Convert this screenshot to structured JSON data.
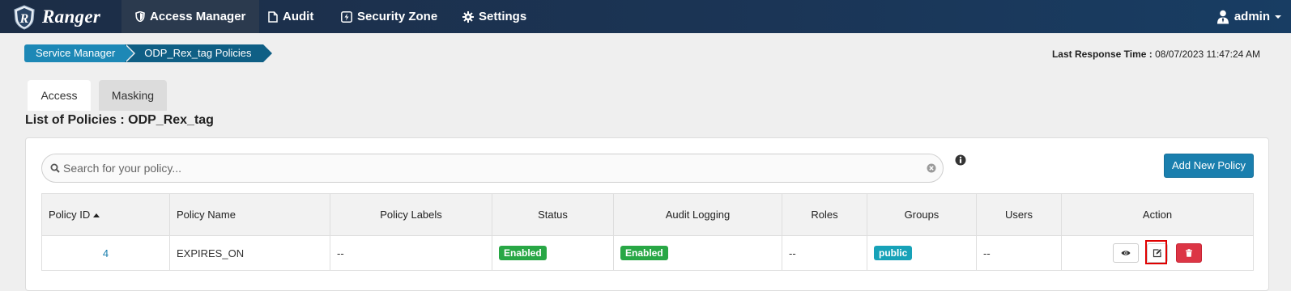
{
  "navbar": {
    "brand": "Ranger",
    "items": [
      {
        "label": "Access Manager",
        "icon": "shield-icon",
        "active": true
      },
      {
        "label": "Audit",
        "icon": "file-icon",
        "active": false
      },
      {
        "label": "Security Zone",
        "icon": "bolt-icon",
        "active": false
      },
      {
        "label": "Settings",
        "icon": "gear-icon",
        "active": false
      }
    ],
    "user": "admin"
  },
  "breadcrumb": [
    "Service Manager",
    "ODP_Rex_tag Policies"
  ],
  "last_response": {
    "label": "Last Response Time :",
    "value": "08/07/2023 11:47:24 AM"
  },
  "tabs": [
    "Access",
    "Masking"
  ],
  "page_title": "List of Policies : ODP_Rex_tag",
  "search": {
    "placeholder": "Search for your policy..."
  },
  "add_button": "Add New Policy",
  "table": {
    "columns": [
      "Policy ID",
      "Policy Name",
      "Policy Labels",
      "Status",
      "Audit Logging",
      "Roles",
      "Groups",
      "Users",
      "Action"
    ],
    "rows": [
      {
        "id": "4",
        "name": "EXPIRES_ON",
        "labels": "--",
        "status": "Enabled",
        "audit": "Enabled",
        "roles": "--",
        "groups": "public",
        "users": "--"
      }
    ]
  },
  "colors": {
    "accent": "#1a7fae",
    "enabled": "#28a745",
    "group_badge": "#17a2b8",
    "delete": "#dc3545",
    "highlight": "#e00000"
  }
}
